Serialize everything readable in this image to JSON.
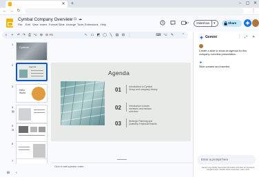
{
  "browser": {
    "tab_title": "",
    "tab_close": "✕",
    "new_tab": "+",
    "window_controls": [
      "–",
      "▢",
      "✕"
    ],
    "nav_icons": [
      "←",
      "→",
      "↻"
    ]
  },
  "app": {
    "doc_title": "Cymbal Company Overview",
    "title_icons": [
      "☆",
      "⊡",
      "☁"
    ],
    "menu": [
      "File",
      "Edit",
      "View",
      "Insert",
      "Format",
      "Slide",
      "Arrange",
      "Tools",
      "Extensions",
      "Help"
    ],
    "header_icons": [
      "history-icon",
      "comment-icon",
      "camera-icon"
    ],
    "slideshow_label": "Slideshow",
    "share_label": "Share"
  },
  "toolbar": {
    "left_icons": [
      "⌕",
      "+",
      "↶",
      "↷",
      "⎙",
      "⌥",
      "⊕",
      "⊖",
      "%"
    ],
    "zoom_label": "Fit",
    "right_icons": [
      "↖",
      "▭",
      "◩",
      "◯",
      "╲",
      "▤",
      "⊞",
      "⋮"
    ],
    "end_icons": [
      "⌨",
      "⌥",
      "✎",
      "⌃"
    ]
  },
  "filmstrip": {
    "numbers": [
      "1",
      "2",
      "3",
      "4",
      "5",
      "6",
      "7"
    ],
    "thumb1_title": "Cymbal",
    "thumb2_title": "Agenda",
    "thumb3_title": "Hello World"
  },
  "slide": {
    "title": "Agenda",
    "items": [
      {
        "num": "01",
        "text": "Introduction to Cymbal Group and company history"
      },
      {
        "num": "02",
        "text": "Introduction to team members and mission overview"
      },
      {
        "num": "03",
        "text": "Strategic Planning and Quarterly Financial Results"
      }
    ]
  },
  "notes": {
    "placeholder": "Click to add speaker notes"
  },
  "gemini": {
    "title": "Gemini",
    "prompt": "Create a slide to show an agenda for this company overview presentation.",
    "status": "Slide created and inserted",
    "input_placeholder": "Enter a prompt here",
    "disclaimer": "Gemini may display inaccurate information and does not represent Google's views. Double-check responses. Learn more",
    "header_icons": [
      "⋮",
      "⤢",
      "✕"
    ]
  },
  "colors": {
    "accent": "#0b57d0",
    "share_bg": "#c2e7ff",
    "logo": "#f4b400",
    "slide_bg": "#e8eae7"
  }
}
